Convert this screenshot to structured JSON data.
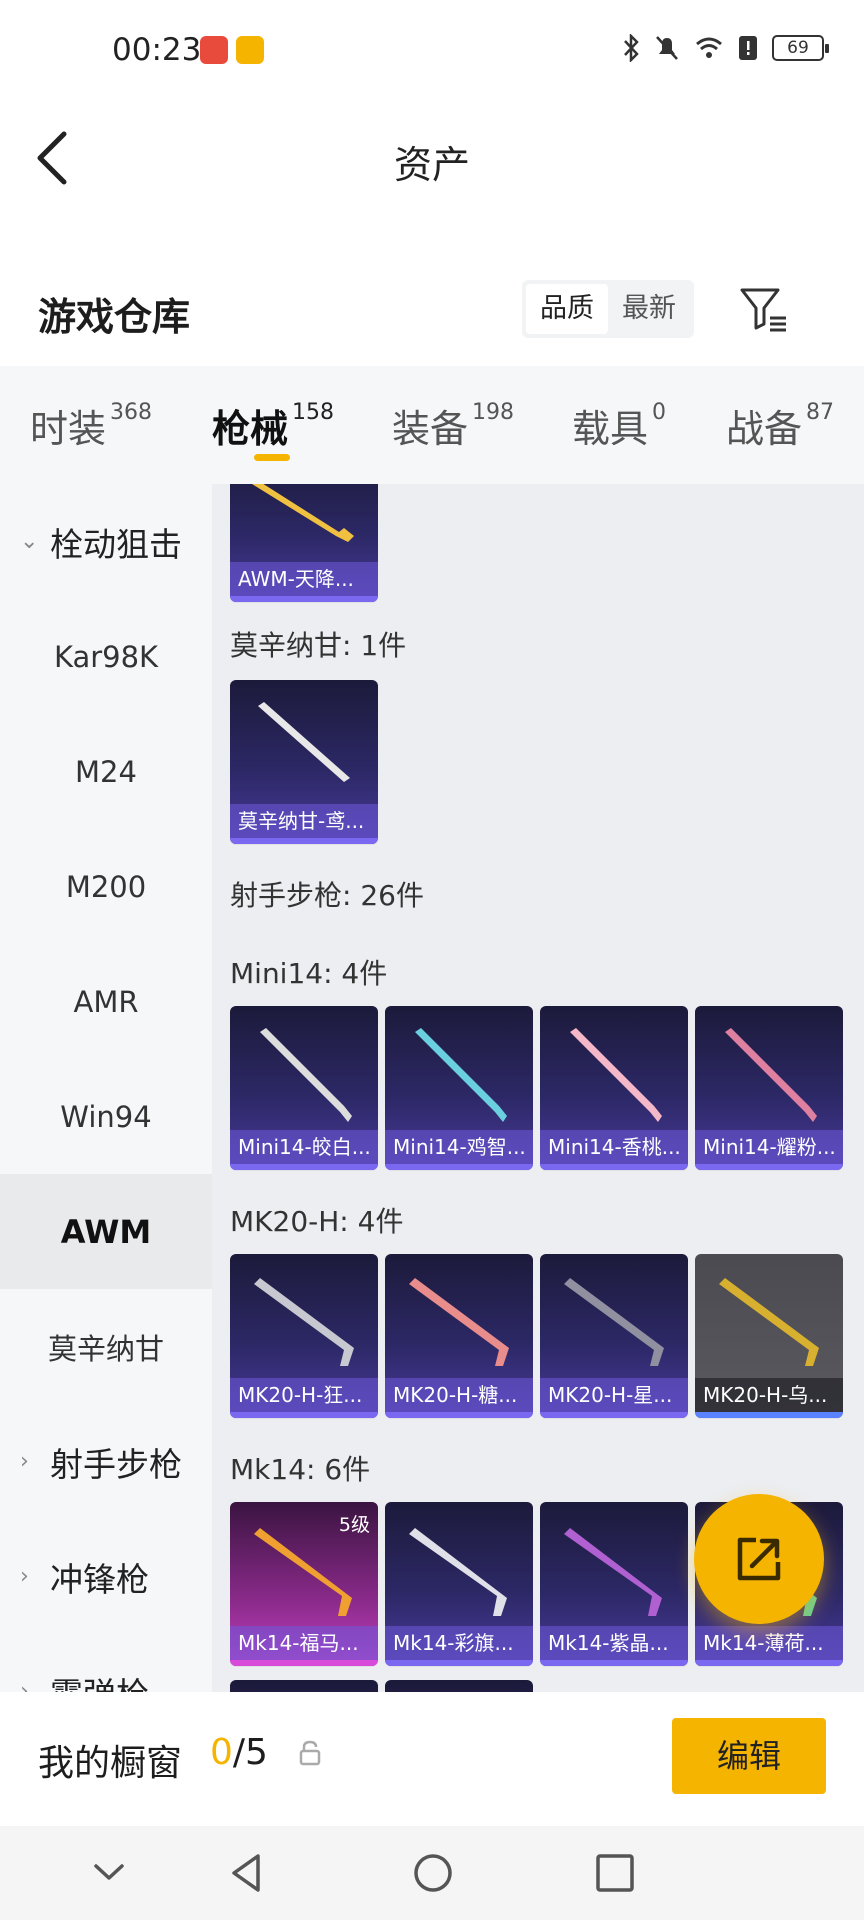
{
  "status_bar": {
    "time": "00:23",
    "battery": "69",
    "icons": [
      "bluetooth-icon",
      "mute-bell-icon",
      "wifi-icon",
      "alert-icon",
      "battery-icon"
    ]
  },
  "header": {
    "title": "资产"
  },
  "warehouse": {
    "title": "游戏仓库",
    "sort_options": [
      "品质",
      "最新"
    ],
    "active_sort": "品质"
  },
  "tabs": [
    {
      "label": "时装",
      "count": "368"
    },
    {
      "label": "枪械",
      "count": "158",
      "active": true
    },
    {
      "label": "装备",
      "count": "198"
    },
    {
      "label": "载具",
      "count": "0"
    },
    {
      "label": "战备",
      "count": "87"
    }
  ],
  "sidebar": {
    "items": [
      {
        "label": "栓动狙击",
        "type": "category",
        "expanded": true
      },
      {
        "label": "Kar98K"
      },
      {
        "label": "M24"
      },
      {
        "label": "M200"
      },
      {
        "label": "AMR"
      },
      {
        "label": "Win94"
      },
      {
        "label": "AWM",
        "active": true
      },
      {
        "label": "莫辛纳甘"
      },
      {
        "label": "射手步枪",
        "type": "category"
      },
      {
        "label": "冲锋枪",
        "type": "category"
      },
      {
        "label": "霰弹枪",
        "type": "category"
      }
    ]
  },
  "content": {
    "groups": [
      {
        "label": "",
        "items": [
          {
            "name": "AWM-天降...",
            "color": "#f0c040"
          }
        ]
      },
      {
        "label": "莫辛纳甘: 1件",
        "items": [
          {
            "name": "莫辛纳甘-鸢...",
            "color": "#e8e8e8"
          }
        ]
      },
      {
        "label": "射手步枪: 26件",
        "items": []
      },
      {
        "label": "Mini14: 4件",
        "items": [
          {
            "name": "Mini14-皎白...",
            "color": "#dddddd"
          },
          {
            "name": "Mini14-鸡智...",
            "color": "#6ad0e0"
          },
          {
            "name": "Mini14-香桃...",
            "color": "#f5b8c8"
          },
          {
            "name": "Mini14-耀粉...",
            "color": "#e080a0"
          }
        ]
      },
      {
        "label": "MK20-H: 4件",
        "items": [
          {
            "name": "MK20-H-狂...",
            "color": "#c8c8d0"
          },
          {
            "name": "MK20-H-糖...",
            "color": "#e88c8c"
          },
          {
            "name": "MK20-H-星...",
            "color": "#9090a0"
          },
          {
            "name": "MK20-H-乌...",
            "color": "#d8b030"
          }
        ]
      },
      {
        "label": "Mk14: 6件",
        "items": [
          {
            "name": "Mk14-福马...",
            "color": "#f0a030",
            "level": "5级"
          },
          {
            "name": "Mk14-彩旗...",
            "color": "#e0e0e8"
          },
          {
            "name": "Mk14-紫晶...",
            "color": "#b060d0"
          },
          {
            "name": "Mk14-薄荷...",
            "color": "#60d0a0"
          }
        ]
      }
    ]
  },
  "showcase": {
    "title": "我的橱窗",
    "current": "0",
    "separator": "/",
    "total": "5",
    "edit_label": "编辑"
  },
  "colors": {
    "accent": "#f5b400",
    "card_purple": "#2c2866",
    "caption": "#6e5adc"
  }
}
